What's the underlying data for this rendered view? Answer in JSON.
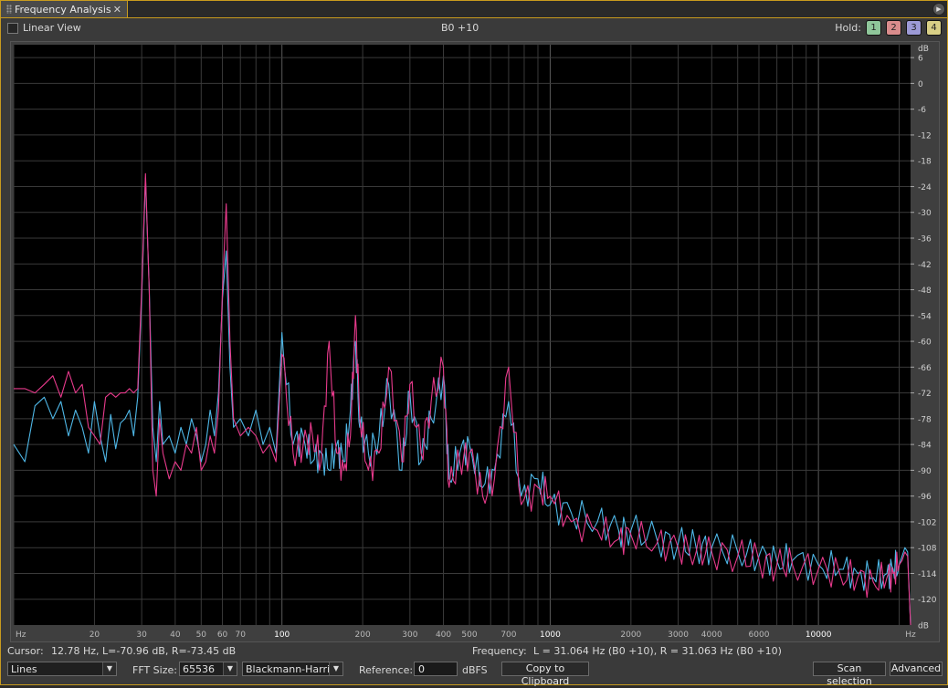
{
  "window": {
    "tab_title": "Frequency Analysis"
  },
  "toolbar": {
    "linear_view_label": "Linear View",
    "linear_view_checked": false,
    "note_readout": "B0 +10",
    "hold_label": "Hold:",
    "hold_buttons": [
      {
        "label": "1",
        "color": "#8fc69a"
      },
      {
        "label": "2",
        "color": "#d98c8c"
      },
      {
        "label": "3",
        "color": "#9c9ad6"
      },
      {
        "label": "4",
        "color": "#d8cf86"
      }
    ]
  },
  "status": {
    "cursor_label": "Cursor:",
    "cursor_value": "12.78 Hz, L=-70.96 dB, R=-73.45 dB",
    "frequency_label": "Frequency:",
    "frequency_value": "L = 31.064 Hz (B0 +10), R = 31.063 Hz (B0 +10)"
  },
  "controls": {
    "display_mode": "Lines",
    "fft_size_label": "FFT Size:",
    "fft_size": "65536",
    "window_function": "Blackmann-Harris",
    "reference_label": "Reference:",
    "reference_value": "0",
    "reference_unit": "dBFS",
    "copy_button": "Copy to Clipboard",
    "scan_button": "Scan selection",
    "advanced_button": "Advanced"
  },
  "chart_data": {
    "type": "line",
    "x_scale": "log",
    "xlim": [
      10,
      22050
    ],
    "ylim": [
      -126,
      6
    ],
    "x_unit": "Hz",
    "y_unit": "dB",
    "x_ticks": [
      "Hz",
      "20",
      "30",
      "40",
      "50",
      "60",
      "70",
      "100",
      "200",
      "300",
      "400",
      "500",
      "700",
      "1000",
      "2000",
      "3000",
      "4000",
      "6000",
      "10000",
      "Hz"
    ],
    "x_tick_values": [
      10.5,
      20,
      30,
      40,
      50,
      60,
      70,
      100,
      200,
      300,
      400,
      500,
      700,
      1000,
      2000,
      3000,
      4000,
      6000,
      10000,
      22050
    ],
    "y_ticks": [
      "dB",
      "6",
      "0",
      "-6",
      "-12",
      "-18",
      "-24",
      "-30",
      "-36",
      "-42",
      "-48",
      "-54",
      "-60",
      "-66",
      "-72",
      "-78",
      "-84",
      "-90",
      "-96",
      "-102",
      "-108",
      "-114",
      "-120",
      "dB"
    ],
    "y_tick_values": [
      9,
      6,
      0,
      -6,
      -12,
      -18,
      -24,
      -30,
      -36,
      -42,
      -48,
      -54,
      -60,
      -66,
      -72,
      -78,
      -84,
      -90,
      -96,
      -102,
      -108,
      -114,
      -120,
      -126
    ],
    "grid": true,
    "background": "#000000",
    "series": [
      {
        "channel": "R",
        "color": "#4fb8e8",
        "x": [
          10,
          11,
          12,
          13,
          14,
          15,
          16,
          17,
          18,
          19,
          20,
          21,
          22,
          23,
          24,
          25,
          26,
          27,
          28,
          29,
          30,
          31,
          32,
          33,
          34,
          35,
          36,
          38,
          40,
          42,
          44,
          46,
          48,
          50,
          52,
          54,
          56,
          58,
          60,
          62,
          64,
          66,
          70,
          75,
          80,
          85,
          90,
          95,
          100,
          110,
          120,
          130,
          140,
          150,
          160,
          170,
          180,
          188,
          195,
          210,
          230,
          250,
          280,
          300,
          330,
          360,
          400,
          420,
          460,
          500,
          560,
          620,
          700,
          780,
          900,
          1000,
          1200,
          1500,
          1800,
          2000,
          2500,
          3000,
          3500,
          4000,
          5000,
          6000,
          7000,
          8000,
          10000,
          12000,
          14000,
          16000,
          18000,
          19000,
          20000,
          20500,
          21000,
          21500,
          22050
        ],
        "y": [
          -84,
          -88,
          -75,
          -73,
          -78,
          -74,
          -82,
          -76,
          -80,
          -86,
          -74,
          -82,
          -88,
          -77,
          -85,
          -79,
          -78,
          -76,
          -82,
          -73,
          -50,
          -22,
          -48,
          -80,
          -88,
          -74,
          -84,
          -82,
          -86,
          -80,
          -84,
          -78,
          -82,
          -88,
          -84,
          -76,
          -82,
          -72,
          -50,
          -39,
          -66,
          -80,
          -78,
          -82,
          -76,
          -84,
          -80,
          -86,
          -58,
          -84,
          -82,
          -88,
          -86,
          -90,
          -84,
          -88,
          -76,
          -60,
          -80,
          -86,
          -82,
          -70,
          -90,
          -72,
          -88,
          -78,
          -68,
          -92,
          -86,
          -84,
          -94,
          -90,
          -74,
          -96,
          -92,
          -98,
          -100,
          -102,
          -104,
          -104,
          -106,
          -107,
          -108,
          -108,
          -109,
          -110,
          -111,
          -111,
          -112,
          -113,
          -114,
          -115,
          -114,
          -113,
          -112,
          -110,
          -108,
          -109,
          -127
        ]
      },
      {
        "channel": "L",
        "color": "#e83a8c",
        "x": [
          10,
          11,
          12,
          13,
          14,
          15,
          16,
          17,
          18,
          19,
          20,
          21,
          22,
          23,
          24,
          25,
          26,
          27,
          28,
          29,
          30,
          31,
          32,
          33,
          34,
          35,
          36,
          38,
          40,
          42,
          44,
          46,
          48,
          50,
          52,
          54,
          56,
          58,
          60,
          62,
          64,
          66,
          70,
          75,
          80,
          85,
          90,
          95,
          100,
          110,
          120,
          130,
          140,
          150,
          160,
          170,
          180,
          188,
          195,
          210,
          230,
          250,
          280,
          300,
          330,
          360,
          400,
          420,
          460,
          500,
          560,
          620,
          700,
          780,
          900,
          1000,
          1200,
          1500,
          1800,
          2000,
          2500,
          3000,
          3500,
          4000,
          5000,
          6000,
          7000,
          8000,
          10000,
          12000,
          14000,
          16000,
          18000,
          19000,
          20000,
          20500,
          21000,
          21500,
          22050
        ],
        "y": [
          -71,
          -71,
          -72,
          -70,
          -68,
          -73,
          -67,
          -72,
          -70,
          -80,
          -82,
          -84,
          -73,
          -72,
          -73,
          -72,
          -72,
          -71,
          -72,
          -71,
          -48,
          -21,
          -48,
          -90,
          -96,
          -78,
          -86,
          -92,
          -88,
          -90,
          -84,
          -86,
          -80,
          -90,
          -88,
          -82,
          -86,
          -76,
          -48,
          -28,
          -60,
          -78,
          -82,
          -80,
          -82,
          -86,
          -84,
          -88,
          -63,
          -86,
          -84,
          -82,
          -88,
          -60,
          -86,
          -90,
          -82,
          -54,
          -78,
          -90,
          -86,
          -66,
          -88,
          -70,
          -86,
          -74,
          -66,
          -94,
          -88,
          -86,
          -96,
          -92,
          -66,
          -98,
          -94,
          -96,
          -102,
          -104,
          -106,
          -105,
          -107,
          -108,
          -109,
          -109,
          -110,
          -111,
          -112,
          -112,
          -113,
          -114,
          -115,
          -116,
          -115,
          -114,
          -112,
          -111,
          -109,
          -110,
          -127
        ]
      }
    ],
    "peak_annotations": []
  }
}
